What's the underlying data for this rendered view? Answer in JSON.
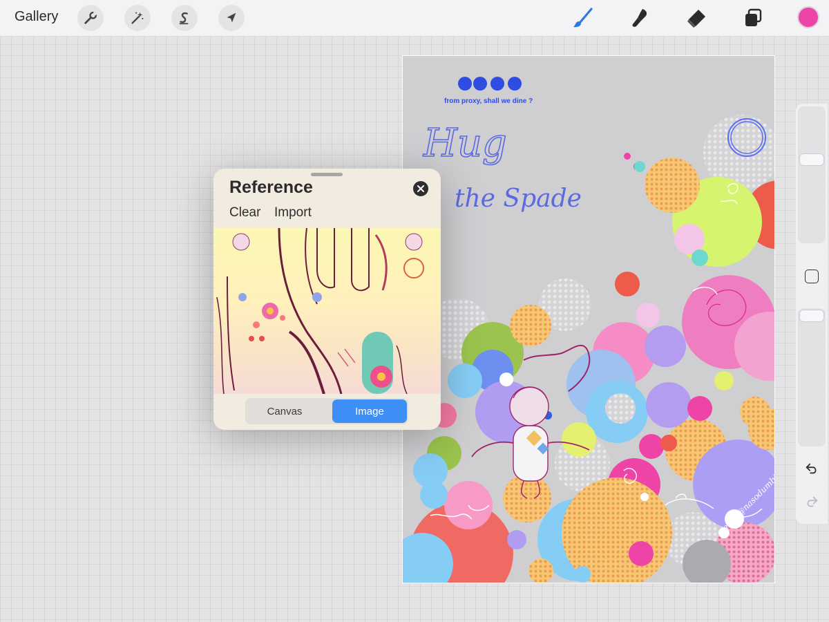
{
  "toolbar": {
    "gallery_label": "Gallery",
    "left_tools": [
      "wrench-icon",
      "magic-wand-icon",
      "selection-icon",
      "transform-arrow-icon"
    ],
    "right_tools": [
      "brush-icon",
      "smudge-icon",
      "eraser-icon",
      "layers-icon"
    ],
    "active_tool": "brush-icon",
    "active_tool_color": "#2f78e0",
    "current_color": "#ee44a8"
  },
  "artwork": {
    "top_text": "from proxy, shall we dine ?",
    "title_line1": "Hug",
    "title_line2": "the Spade",
    "signature": "jesta/@nasodumbi",
    "text_color": "#5b6ae0"
  },
  "reference_panel": {
    "title": "Reference",
    "clear_label": "Clear",
    "import_label": "Import",
    "segment_canvas": "Canvas",
    "segment_image": "Image",
    "selected_segment": "Image",
    "accent_color": "#3d8ef5"
  },
  "sidebar": {
    "undo_icon": "undo-icon",
    "redo_icon": "redo-icon"
  }
}
